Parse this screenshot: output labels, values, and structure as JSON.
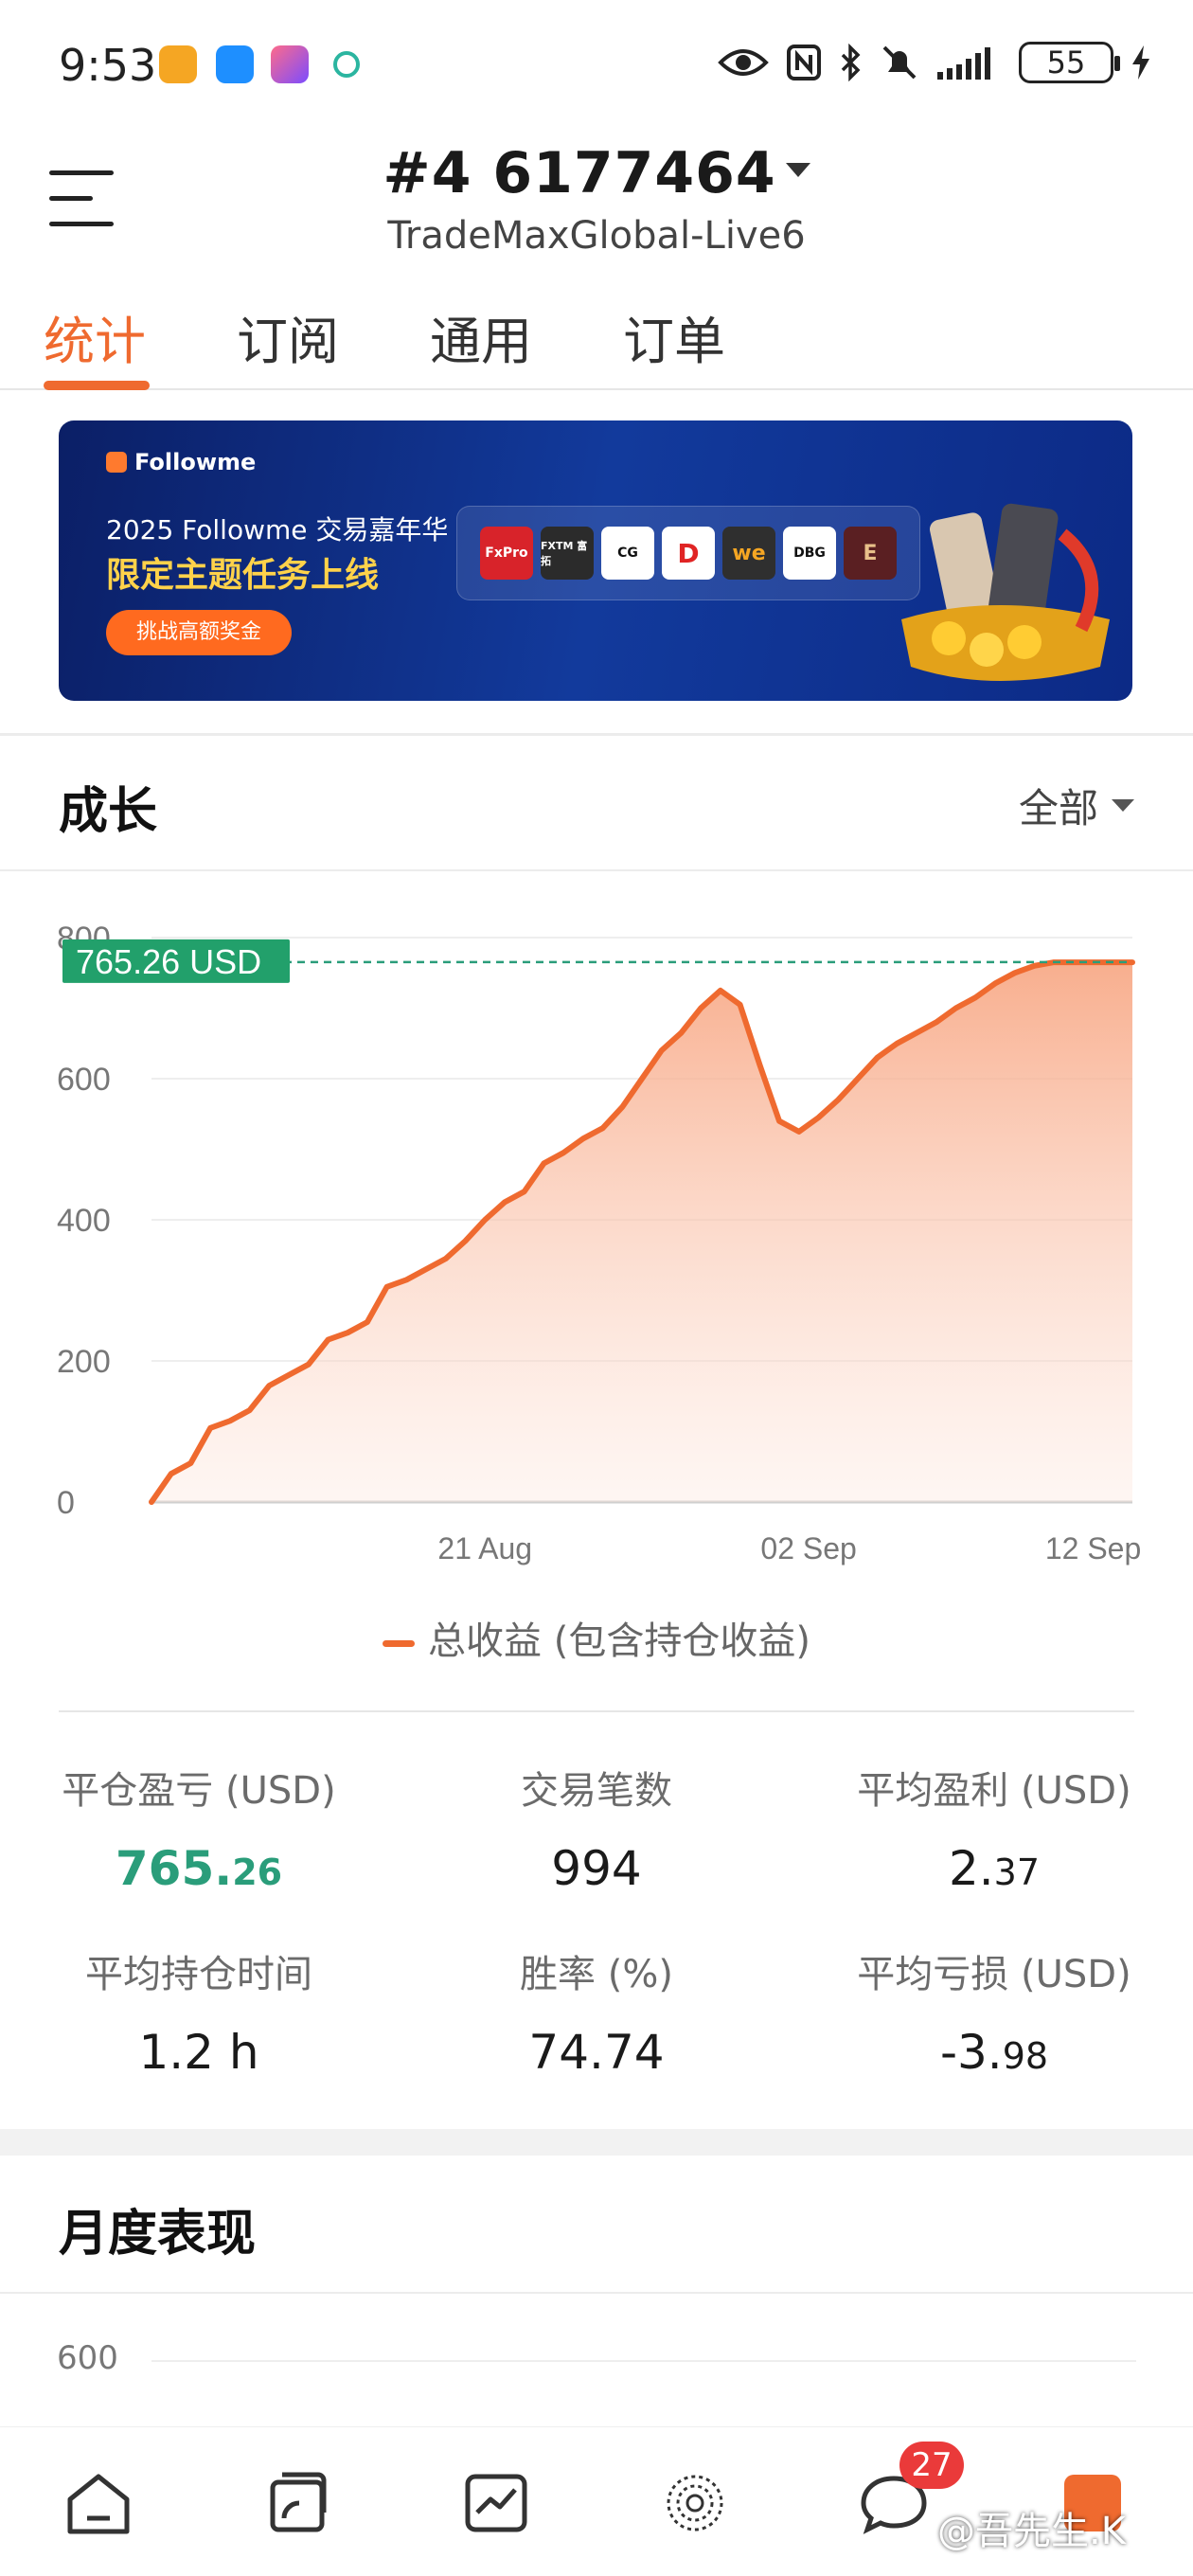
{
  "status_bar": {
    "time": "9:53",
    "battery": "55"
  },
  "header": {
    "account_number": "#4  6177464",
    "server": "TradeMaxGlobal-Live6"
  },
  "tabs": [
    {
      "label": "统计",
      "active": true
    },
    {
      "label": "订阅",
      "active": false
    },
    {
      "label": "通用",
      "active": false
    },
    {
      "label": "订单",
      "active": false
    }
  ],
  "banner": {
    "brand": "Followme",
    "line1": "2025 Followme 交易嘉年华",
    "line2": "限定主题任务上线",
    "button": "挑战高额奖金",
    "partners": [
      "FxPro",
      "FXTM 富拓",
      "CG",
      "D",
      "we",
      "DBG",
      "E"
    ]
  },
  "growth": {
    "title": "成长",
    "filter": "全部",
    "current_label": "765.26 USD",
    "legend": "总收益 (包含持仓收益)"
  },
  "chart_data": {
    "type": "area",
    "title": "",
    "xlabel": "",
    "ylabel": "",
    "ylim": [
      0,
      800
    ],
    "yticks": [
      "0",
      "200",
      "400",
      "600",
      "800"
    ],
    "xticks": [
      {
        "label": "21 Aug",
        "pos": 0.34
      },
      {
        "label": "02 Sep",
        "pos": 0.67
      },
      {
        "label": "12 Sep",
        "pos": 0.96
      }
    ],
    "current_value": 765.26,
    "series": [
      {
        "name": "总收益 (包含持仓收益)",
        "color": "#ef6a2f",
        "x": [
          0,
          0.02,
          0.04,
          0.06,
          0.08,
          0.1,
          0.12,
          0.14,
          0.16,
          0.18,
          0.2,
          0.22,
          0.24,
          0.26,
          0.28,
          0.3,
          0.32,
          0.34,
          0.36,
          0.38,
          0.4,
          0.42,
          0.44,
          0.46,
          0.48,
          0.5,
          0.52,
          0.54,
          0.56,
          0.58,
          0.6,
          0.62,
          0.64,
          0.66,
          0.68,
          0.7,
          0.71,
          0.72,
          0.73,
          0.74,
          0.75,
          0.76,
          0.78,
          0.8,
          0.82,
          0.84,
          0.86,
          0.88,
          0.9,
          0.92,
          0.94,
          0.96,
          0.98,
          1.0
        ],
        "y": [
          0,
          40,
          55,
          105,
          115,
          130,
          165,
          180,
          195,
          230,
          240,
          255,
          305,
          315,
          330,
          345,
          370,
          400,
          425,
          440,
          480,
          495,
          515,
          530,
          560,
          600,
          640,
          665,
          700,
          725,
          705,
          620,
          540,
          525,
          545,
          570,
          585,
          600,
          615,
          630,
          640,
          650,
          665,
          680,
          700,
          715,
          735,
          750,
          760,
          765,
          765,
          765,
          765,
          765
        ]
      }
    ]
  },
  "stats": [
    {
      "label": "平仓盈亏 (USD)",
      "value_main": "765.",
      "value_small": "26",
      "green": true
    },
    {
      "label": "交易笔数",
      "value_main": "994",
      "value_small": "",
      "green": false
    },
    {
      "label": "平均盈利 (USD)",
      "value_main": "2.",
      "value_small": "37",
      "green": false
    },
    {
      "label": "平均持仓时间",
      "value_main": "1.2 h",
      "value_small": "",
      "green": false
    },
    {
      "label": "胜率 (%)",
      "value_main": "74.74",
      "value_small": "",
      "green": false
    },
    {
      "label": "平均亏损 (USD)",
      "value_main": "-3.",
      "value_small": "98",
      "green": false
    }
  ],
  "monthly": {
    "title": "月度表现",
    "axis_top": "600"
  },
  "bottom_nav": {
    "badge": "27",
    "watermark": "@吾先生.K"
  },
  "colors": {
    "accent": "#ef6a2f",
    "green": "#2a9d7a",
    "label_green": "#22a06b"
  }
}
